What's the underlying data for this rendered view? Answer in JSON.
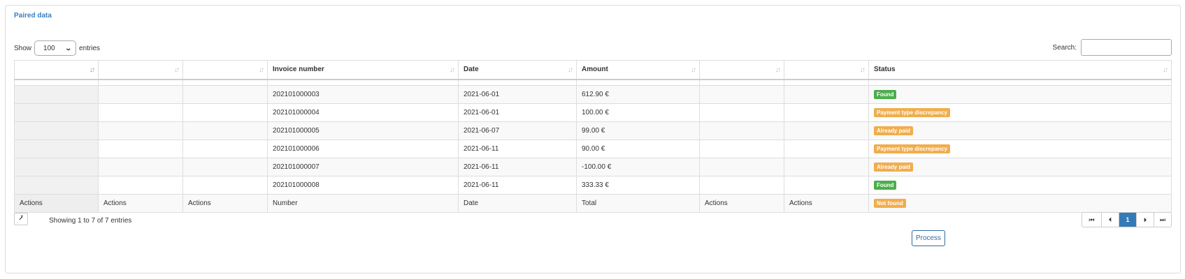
{
  "panel": {
    "title": "Paired data"
  },
  "length": {
    "show_label": "Show",
    "value": "100",
    "entries_label": "entries"
  },
  "search": {
    "label": "Search:",
    "value": ""
  },
  "table": {
    "headers": [
      "",
      "",
      "",
      "Invoice number",
      "Date",
      "Amount",
      "",
      "",
      "Status"
    ],
    "rows": [
      {
        "invoice": "202101000003",
        "date": "2021-06-01",
        "amount": "612.90 €",
        "status": "Found",
        "status_color": "#4cae4c"
      },
      {
        "invoice": "202101000004",
        "date": "2021-06-01",
        "amount": "100.00 €",
        "status": "Payment type discrepancy",
        "status_color": "#f0ad4e"
      },
      {
        "invoice": "202101000005",
        "date": "2021-06-07",
        "amount": "99.00 €",
        "status": "Already paid",
        "status_color": "#f0ad4e"
      },
      {
        "invoice": "202101000006",
        "date": "2021-06-11",
        "amount": "90.00 €",
        "status": "Payment type discrepancy",
        "status_color": "#f0ad4e"
      },
      {
        "invoice": "202101000007",
        "date": "2021-06-11",
        "amount": "-100.00 €",
        "status": "Already paid",
        "status_color": "#f0ad4e"
      },
      {
        "invoice": "202101000008",
        "date": "2021-06-11",
        "amount": "333.33 €",
        "status": "Found",
        "status_color": "#4cae4c"
      }
    ],
    "footer": [
      "Actions",
      "Actions",
      "Actions",
      "Number",
      "Date",
      "Total",
      "Actions",
      "Actions",
      "Not found"
    ]
  },
  "info": "Showing 1 to 7 of 7 entries",
  "pagination": {
    "first": "⏮",
    "prev": "⏴",
    "current": "1",
    "next": "⏵",
    "last": "⏭"
  },
  "process_button": "Process",
  "icons": {
    "export": "export-icon",
    "sort": "sort-icon"
  }
}
